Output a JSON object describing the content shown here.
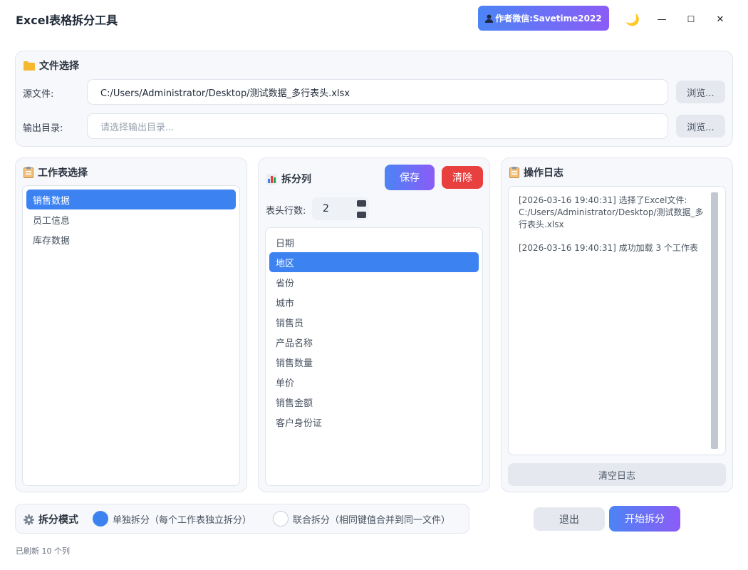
{
  "app": {
    "title": "Excel表格拆分工具",
    "author": "作者微信:Savetime2022",
    "controls": {
      "theme": "🌙",
      "minimize": "—",
      "maximize": "☐",
      "close": "✕"
    }
  },
  "file_select": {
    "title": "文件选择",
    "source_label": "源文件:",
    "source_value": "C:/Users/Administrator/Desktop/测试数据_多行表头.xlsx",
    "output_label": "输出目录:",
    "output_placeholder": "请选择输出目录...",
    "browse_label": "浏览..."
  },
  "sheets": {
    "title": "工作表选择",
    "items": [
      "销售数据",
      "员工信息",
      "库存数据"
    ]
  },
  "split_columns": {
    "title": "拆分列",
    "save_label": "保存",
    "clear_label": "清除",
    "header_rows_label": "表头行数:",
    "header_rows_value": "2",
    "items": [
      "日期",
      "地区",
      "省份",
      "城市",
      "销售员",
      "产品名称",
      "销售数量",
      "单价",
      "销售金额",
      "客户身份证"
    ]
  },
  "log": {
    "title": "操作日志",
    "lines": [
      "[2026-03-16 19:40:31] 选择了Excel文件: C:/Users/Administrator/Desktop/测试数据_多行表头.xlsx",
      "[2026-03-16 19:40:31] 成功加载 3 个工作表"
    ],
    "clear_label": "清空日志"
  },
  "split_mode": {
    "title": "拆分模式",
    "option_single": "单独拆分（每个工作表独立拆分）",
    "option_joint": "联合拆分（相同键值合并到同一文件）"
  },
  "actions": {
    "exit_label": "退出",
    "start_label": "开始拆分"
  },
  "status": {
    "text": "已刷新 10 个列"
  },
  "colors": {
    "accent": "#3d82f1",
    "gradient_start": "#4c84f5",
    "gradient_end": "#8b5cf6",
    "danger": "#e8403f"
  }
}
